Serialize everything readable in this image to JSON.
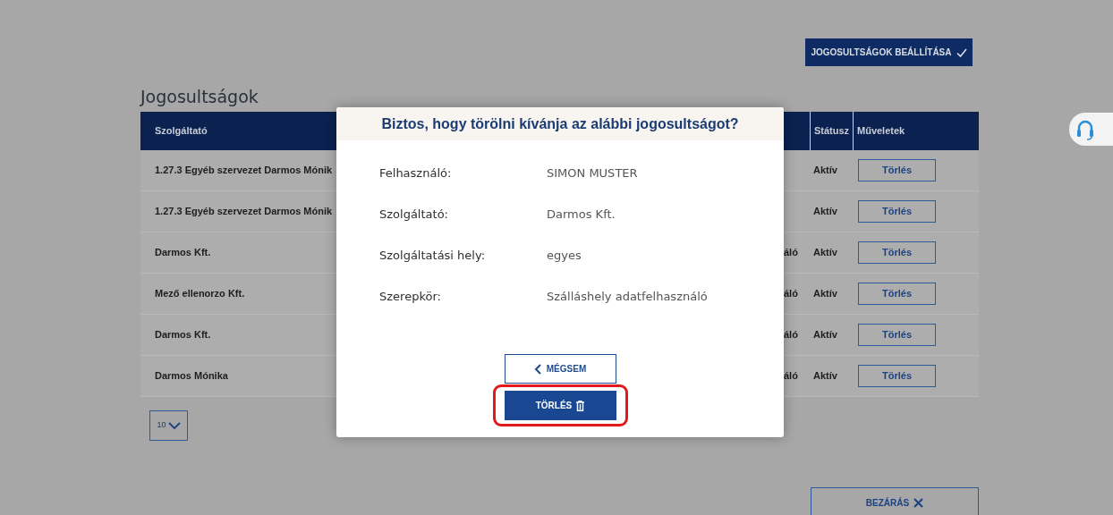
{
  "page": {
    "title": "Jogosultságok",
    "settings_button": "JOGOSULTSÁGOK BEÁLLÍTÁSA",
    "page_size": "10",
    "close_button": "BEZÁRÁS"
  },
  "table": {
    "columns": [
      {
        "kind": "provider",
        "label": "Szolgáltató"
      },
      {
        "kind": "status",
        "label": "Státusz"
      },
      {
        "kind": "actions",
        "label": "Műveletek"
      }
    ],
    "rows": [
      {
        "provider": "1.27.3 Egyéb szervezet Darmos Mónik",
        "status": "Aktív",
        "action": "Törlés"
      },
      {
        "provider": "1.27.3 Egyéb szervezet Darmos Mónik",
        "status": "Aktív",
        "action": "Törlés"
      },
      {
        "provider": "Darmos Kft.",
        "column_3": "áló",
        "status": "Aktív",
        "action": "Törlés"
      },
      {
        "provider": "Mező ellenorzo Kft.",
        "column_3": "áló",
        "status": "Aktív",
        "action": "Törlés"
      },
      {
        "provider": "Darmos Kft.",
        "column_3": "áló",
        "status": "Aktív",
        "action": "Törlés"
      },
      {
        "provider": "Darmos Mónika",
        "column_3": "áló",
        "status": "Aktív",
        "action": "Törlés"
      }
    ]
  },
  "modal": {
    "title": "Biztos, hogy törölni kívánja az alábbi jogosultságot?",
    "fields": [
      {
        "label": "Felhasználó:",
        "value": "SIMON MUSTER"
      },
      {
        "label": "Szolgáltató:",
        "value": "Darmos Kft."
      },
      {
        "label": "Szolgáltatási hely:",
        "value": "egyes"
      },
      {
        "label": "Szerepkör:",
        "value": "Szálláshely adatfelhasználó"
      }
    ],
    "cancel_button": "MÉGSEM",
    "confirm_button": {
      "label": "TÖRLÉS",
      "highlighted": true
    }
  }
}
